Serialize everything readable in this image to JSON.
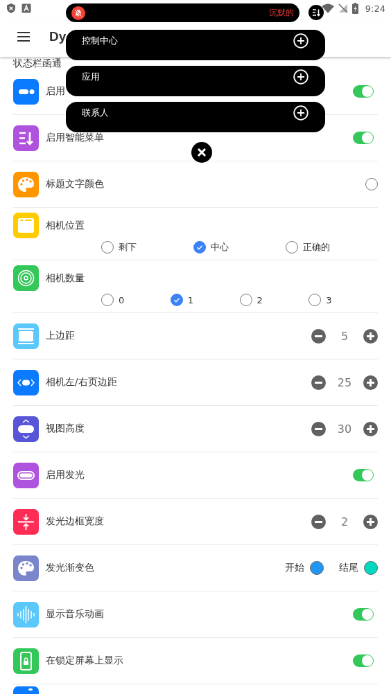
{
  "status_bar": {
    "time": "9:24"
  },
  "app_bar": {
    "title": "Dy"
  },
  "section_header": "状态栏函通",
  "settings": [
    {
      "kind": "toggle",
      "label": "启用",
      "on": true
    },
    {
      "kind": "toggle",
      "label": "启用智能菜单",
      "on": true
    },
    {
      "kind": "radio",
      "label": "标题文字颜色",
      "checked": false
    },
    {
      "kind": "choice",
      "label": "相机位置",
      "options": [
        {
          "label": "剩下",
          "selected": false
        },
        {
          "label": "中心",
          "selected": true
        },
        {
          "label": "正确的",
          "selected": false
        }
      ]
    },
    {
      "kind": "choice",
      "label": "相机数量",
      "options": [
        {
          "label": "0",
          "selected": false
        },
        {
          "label": "1",
          "selected": true
        },
        {
          "label": "2",
          "selected": false
        },
        {
          "label": "3",
          "selected": false
        }
      ]
    },
    {
      "kind": "stepper",
      "label": "上边距",
      "value": "5"
    },
    {
      "kind": "stepper",
      "label": "相机左/右页边距",
      "value": "25"
    },
    {
      "kind": "stepper",
      "label": "视图高度",
      "value": "30"
    },
    {
      "kind": "toggle",
      "label": "启用发光",
      "on": true
    },
    {
      "kind": "stepper",
      "label": "发光边框宽度",
      "value": "2"
    },
    {
      "kind": "colors",
      "label": "发光渐变色",
      "swatches": [
        {
          "label": "开始",
          "color": "#2196f3"
        },
        {
          "label": "结尾",
          "color": "#00d9c0"
        }
      ]
    },
    {
      "kind": "toggle",
      "label": "显示音乐动画",
      "on": true
    },
    {
      "kind": "toggle",
      "label": "在锁定屏幕上显示",
      "on": true
    },
    {
      "kind": "cut"
    }
  ],
  "popup": {
    "status": "沉默的",
    "items": [
      {
        "label": "控制中心"
      },
      {
        "label": "应用"
      },
      {
        "label": "联系人"
      }
    ]
  }
}
